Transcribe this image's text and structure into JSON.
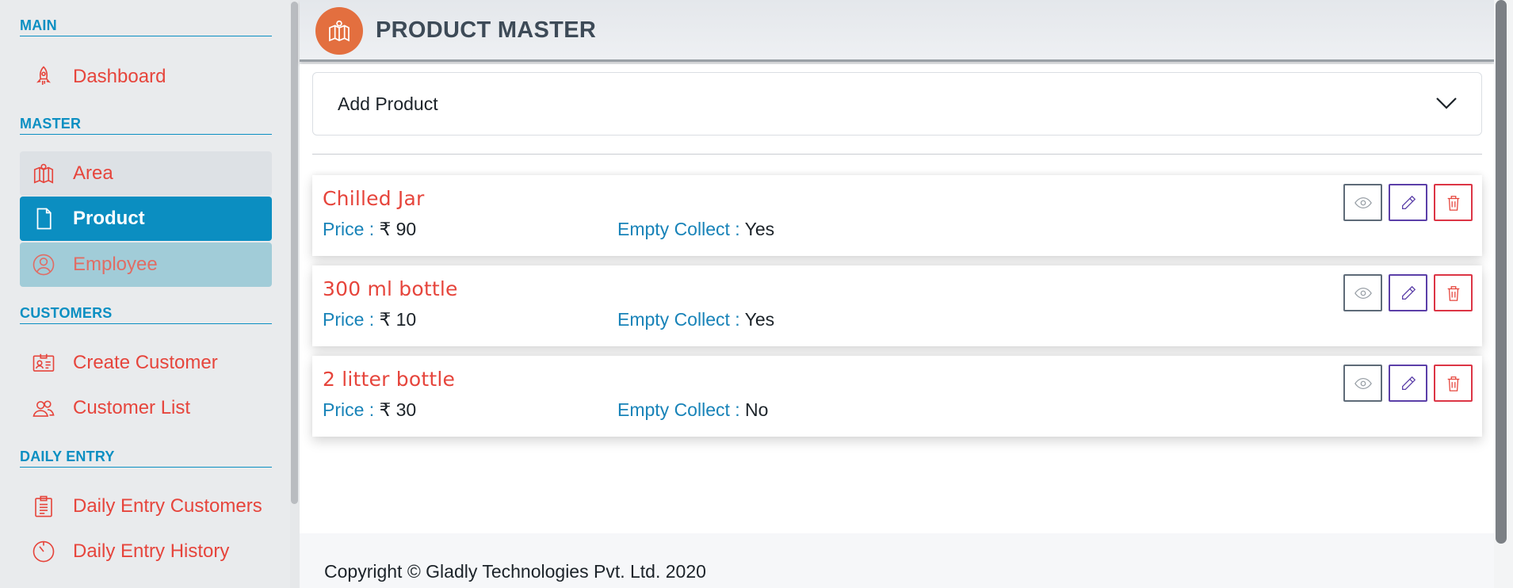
{
  "sidebar": {
    "sections": {
      "main": "MAIN",
      "master": "MASTER",
      "customers": "CUSTOMERS",
      "daily_entry": "DAILY ENTRY"
    },
    "items": {
      "dashboard": {
        "label": "Dashboard",
        "icon": "rocket-icon"
      },
      "area": {
        "label": "Area",
        "icon": "map-icon"
      },
      "product": {
        "label": "Product",
        "icon": "file-icon"
      },
      "employee": {
        "label": "Employee",
        "icon": "user-circle-icon"
      },
      "create_customer": {
        "label": "Create Customer",
        "icon": "id-card-icon"
      },
      "customer_list": {
        "label": "Customer List",
        "icon": "users-icon"
      },
      "daily_entry_customers": {
        "label": "Daily Entry Customers",
        "icon": "clipboard-icon"
      },
      "daily_entry_history": {
        "label": "Daily Entry History",
        "icon": "timer-icon"
      }
    }
  },
  "header": {
    "title": "PRODUCT MASTER",
    "icon": "map-icon"
  },
  "add_panel": {
    "label": "Add Product",
    "icon": "chevron-down-icon"
  },
  "products": [
    {
      "name": "Chilled Jar",
      "price_label": "Price :",
      "price": "₹ 90",
      "empty_label": "Empty Collect :",
      "empty_collect": "Yes"
    },
    {
      "name": "300 ml bottle",
      "price_label": "Price :",
      "price": "₹ 10",
      "empty_label": "Empty Collect :",
      "empty_collect": "Yes"
    },
    {
      "name": "2 litter bottle",
      "price_label": "Price :",
      "price": "₹ 30",
      "empty_label": "Empty Collect :",
      "empty_collect": "No"
    }
  ],
  "actions": {
    "view": "eye-icon",
    "edit": "pencil-icon",
    "delete": "trash-icon"
  },
  "footer": {
    "text": "Copyright © Gladly Technologies Pvt. Ltd. 2020"
  },
  "colors": {
    "accent": "#0b8ec1",
    "danger": "#e6453c",
    "label_blue": "#1883b8",
    "badge_orange": "#e36f3f"
  }
}
